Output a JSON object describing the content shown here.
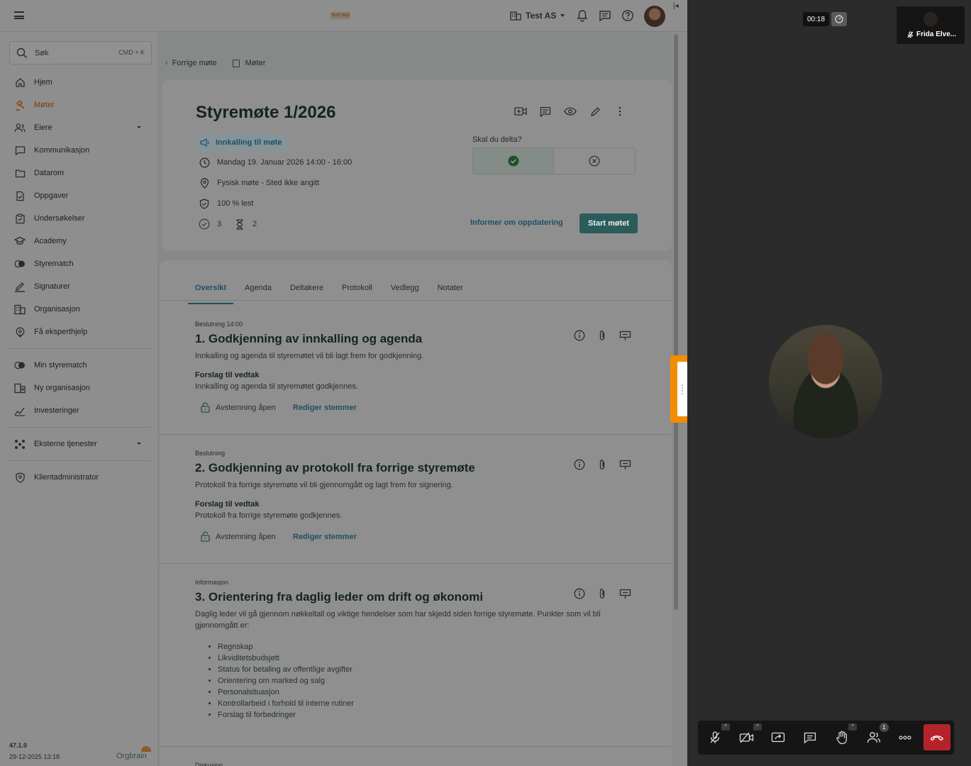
{
  "topbar": {
    "logo_text": "TEST ORG",
    "org_name": "Test AS"
  },
  "search": {
    "placeholder": "Søk",
    "shortcut": "CMD + K"
  },
  "nav": {
    "main": [
      {
        "label": "Hjem",
        "icon": "home-icon"
      },
      {
        "label": "Møter",
        "icon": "gavel-icon",
        "active": true
      },
      {
        "label": "Eiere",
        "icon": "people-icon",
        "has_caret": true
      },
      {
        "label": "Kommunikasjon",
        "icon": "chat-icon"
      },
      {
        "label": "Datarom",
        "icon": "folder-icon"
      },
      {
        "label": "Oppgaver",
        "icon": "task-icon"
      },
      {
        "label": "Undersøkelser",
        "icon": "survey-icon"
      },
      {
        "label": "Academy",
        "icon": "academy-icon"
      },
      {
        "label": "Styrematch",
        "icon": "match-icon"
      },
      {
        "label": "Signaturer",
        "icon": "signature-icon"
      },
      {
        "label": "Organisasjon",
        "icon": "building-icon"
      },
      {
        "label": "Få eksperthjelp",
        "icon": "expert-icon"
      }
    ],
    "secondary": [
      {
        "label": "Min styrematch",
        "icon": "match-icon"
      },
      {
        "label": "Ny organisasjon",
        "icon": "building-add-icon"
      },
      {
        "label": "Investeringer",
        "icon": "chart-icon"
      }
    ],
    "external": {
      "label": "Eksterne tjenester",
      "icon": "apps-icon"
    },
    "admin": {
      "label": "Klientadministrator",
      "icon": "shield-icon"
    }
  },
  "footer": {
    "version": "47.1.0",
    "build_date": "29-12-2025 13:18",
    "brand": "Orgbrain"
  },
  "breadcrumb": {
    "back": "Forrige møte",
    "meetings": "Møter"
  },
  "meeting": {
    "title": "Styremøte 1/2026",
    "status_badge": "Innkalling til møte",
    "datetime": "Mandag 19. Januar 2026 14:00 - 16:00",
    "location": "Fysisk møte - Sted ikke angitt",
    "read_status": "100 % lest",
    "accepted_count": "3",
    "pending_count": "2",
    "rsvp_question": "Skal du delta?",
    "inform_link": "Informer om oppdatering",
    "start_button": "Start møtet"
  },
  "tabs": [
    "Oversikt",
    "Agenda",
    "Deltakere",
    "Protokoll",
    "Vedlegg",
    "Notater"
  ],
  "agenda": [
    {
      "type": "Beslutning 14:00",
      "title": "1. Godkjenning av innkalling og agenda",
      "description": "Innkalling og agenda til styremøtet vil bli lagt frem for godkjenning.",
      "proposal_label": "Forslag til vedtak",
      "proposal": "Innkalling og agenda til styremøtet godkjennes.",
      "vote_status": "Avstemning åpen",
      "edit_votes": "Rediger stemmer"
    },
    {
      "type": "Beslutning",
      "title": "2. Godkjenning av protokoll fra forrige styremøte",
      "description": "Protokoll fra forrige styremøte vil bli gjennomgått og lagt frem for signering.",
      "proposal_label": "Forslag til vedtak",
      "proposal": "Protokoll fra forrige styremøte godkjennes.",
      "vote_status": "Avstemning åpen",
      "edit_votes": "Rediger stemmer"
    },
    {
      "type": "Informasjon",
      "title": "3. Orientering fra daglig leder om drift og økonomi",
      "description": "Daglig leder vil gå gjennom nøkkeltall og viktige hendelser som har skjedd siden forrige styremøte. Punkter som vil bli gjennomgått er:",
      "bullets": [
        "Regnskap",
        "Likviditetsbudsjett",
        "Status for betaling av offentlige avgifter",
        "Orientering om marked og salg",
        "Personalsituasjon",
        "Kontrollarbeid i forhold til interne rutiner",
        "Forslag til forbedringer"
      ]
    }
  ],
  "next_item_type": "Diskusjon",
  "video": {
    "timer": "00:18",
    "self_name": "Frida Elve...",
    "participants_count": "1"
  },
  "colors": {
    "accent_orange": "#f28c00",
    "hangup_red": "#b5232a",
    "primary_teal": "#2b5b5b"
  }
}
